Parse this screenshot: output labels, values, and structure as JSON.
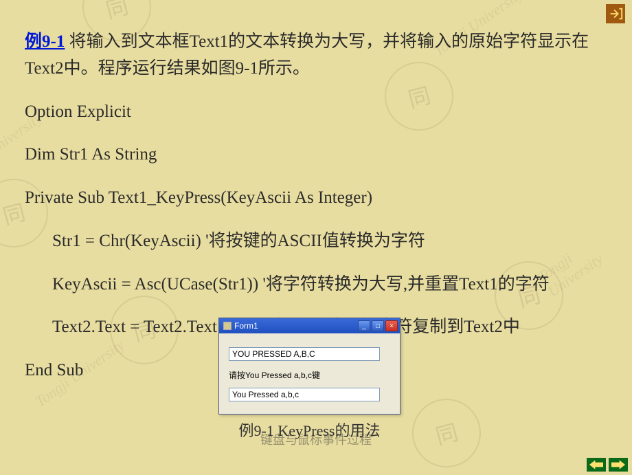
{
  "example": {
    "label": "例9-1",
    "desc1": " 将输入到文本框Text1的文本转换为大写，并将输入的原始字符显示在Text2中。程序运行结果如图9-1所示。"
  },
  "code": {
    "l1": "Option Explicit",
    "l2": "Dim Str1 As String",
    "l3": "Private Sub Text1_KeyPress(KeyAscii As Integer)",
    "l4": "Str1 = Chr(KeyAscii)  '将按键的ASCII值转换为字符",
    "l5": "KeyAscii = Asc(UCase(Str1)) '将字符转换为大写,并重置Text1的字符",
    "l6": "Text2.Text = Text2.Text & Str1 '将输入的原始字符复制到Text2中",
    "l7": "End Sub"
  },
  "window": {
    "title": "Form1",
    "text1_value": "YOU PRESSED A,B,C",
    "label": "请按You Pressed a,b,c键",
    "text2_value": "You Pressed a,b,c"
  },
  "caption": "例9-1  KeyPress的用法",
  "footer": "键盘与鼠标事件过程",
  "watermark_circle": "同",
  "watermark_text": "Tongji University"
}
